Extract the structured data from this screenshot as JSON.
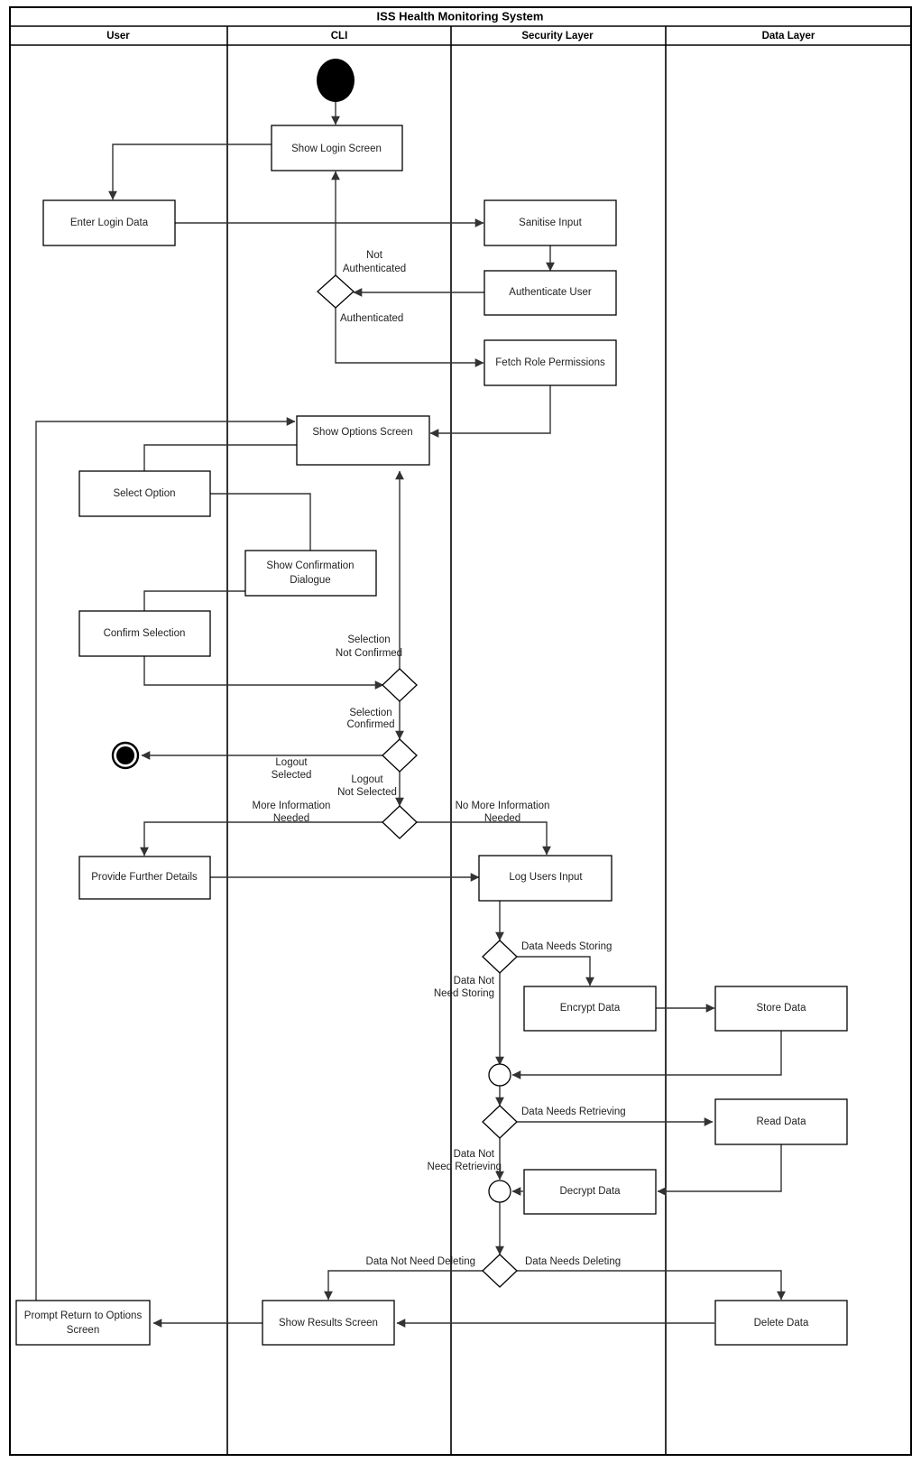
{
  "diagram": {
    "title": "ISS Health Monitoring System",
    "type": "uml-activity-swimlane",
    "lanes": [
      {
        "id": "user",
        "label": "User"
      },
      {
        "id": "cli",
        "label": "CLI"
      },
      {
        "id": "security",
        "label": "Security Layer"
      },
      {
        "id": "data",
        "label": "Data Layer"
      }
    ],
    "nodes": {
      "initial": {
        "label": "",
        "kind": "initial-node",
        "lane": "cli"
      },
      "show_login_screen": {
        "label": "Show  Login Screen",
        "kind": "action",
        "lane": "cli"
      },
      "enter_login_data": {
        "label": "Enter Login Data",
        "kind": "action",
        "lane": "user"
      },
      "sanitise_input": {
        "label": "Sanitise Input",
        "kind": "action",
        "lane": "security"
      },
      "authenticate_user": {
        "label": "Authenticate User",
        "kind": "action",
        "lane": "security"
      },
      "auth_decision": {
        "label": "",
        "kind": "decision",
        "lane": "cli"
      },
      "fetch_role_permissions": {
        "label": "Fetch Role Permissions",
        "kind": "action",
        "lane": "security"
      },
      "show_options_screen": {
        "label": "Show Options Screen",
        "kind": "action",
        "lane": "cli"
      },
      "select_option": {
        "label": "Select Option",
        "kind": "action",
        "lane": "user"
      },
      "show_confirmation_dialogue_line1": {
        "label": "Show Confirmation",
        "kind": "action-line",
        "lane": "cli"
      },
      "show_confirmation_dialogue_line2": {
        "label": "Dialogue",
        "kind": "action-line",
        "lane": "cli"
      },
      "confirm_selection": {
        "label": "Confirm Selection",
        "kind": "action",
        "lane": "user"
      },
      "confirm_decision": {
        "label": "",
        "kind": "decision",
        "lane": "cli"
      },
      "logout_decision": {
        "label": "",
        "kind": "decision",
        "lane": "cli"
      },
      "final": {
        "label": "",
        "kind": "final-node",
        "lane": "user"
      },
      "more_info_decision": {
        "label": "",
        "kind": "decision",
        "lane": "cli"
      },
      "provide_further_details": {
        "label": "Provide Further Details",
        "kind": "action",
        "lane": "user"
      },
      "log_users_input": {
        "label": "Log Users Input",
        "kind": "action",
        "lane": "security"
      },
      "store_decision": {
        "label": "",
        "kind": "decision",
        "lane": "security"
      },
      "encrypt_data": {
        "label": "Encrypt Data",
        "kind": "action",
        "lane": "security"
      },
      "store_data": {
        "label": "Store Data",
        "kind": "action",
        "lane": "data"
      },
      "merge_store": {
        "label": "",
        "kind": "merge",
        "lane": "security"
      },
      "retrieve_decision": {
        "label": "",
        "kind": "decision",
        "lane": "security"
      },
      "read_data": {
        "label": "Read Data",
        "kind": "action",
        "lane": "data"
      },
      "decrypt_data": {
        "label": "Decrypt Data",
        "kind": "action",
        "lane": "security"
      },
      "merge_retrieve": {
        "label": "",
        "kind": "merge",
        "lane": "security"
      },
      "delete_decision": {
        "label": "",
        "kind": "decision",
        "lane": "security"
      },
      "delete_data": {
        "label": "Delete Data",
        "kind": "action",
        "lane": "data"
      },
      "show_results_screen": {
        "label": "Show Results Screen",
        "kind": "action",
        "lane": "cli"
      },
      "prompt_return_line1": {
        "label": "Prompt Return to Options",
        "kind": "action-line",
        "lane": "user"
      },
      "prompt_return_line2": {
        "label": "Screen",
        "kind": "action-line",
        "lane": "user"
      }
    },
    "edge_labels": {
      "not_authenticated_l1": "Not",
      "not_authenticated_l2": "Authenticated",
      "authenticated": "Authenticated",
      "selection_not_confirmed_l1": "Selection",
      "selection_not_confirmed_l2": "Not Confirmed",
      "selection_confirmed_l1": "Selection",
      "selection_confirmed_l2": "Confirmed",
      "logout_selected_l1": "Logout",
      "logout_selected_l2": "Selected",
      "logout_not_selected_l1": "Logout",
      "logout_not_selected_l2": "Not Selected",
      "more_information_needed_l1": "More Information",
      "more_information_needed_l2": "Needed",
      "no_more_information_needed_l1": "No More Information",
      "no_more_information_needed_l2": "Needed",
      "data_needs_storing": "Data Needs Storing",
      "data_not_need_storing_l1": "Data Not",
      "data_not_need_storing_l2": "Need Storing",
      "data_needs_retrieving": "Data Needs Retrieving",
      "data_not_need_retrieving_l1": "Data Not",
      "data_not_need_retrieving_l2": "Need Retrieving",
      "data_needs_deleting": "Data Needs Deleting",
      "data_not_need_deleting": "Data Not Need Deleting"
    },
    "colors": {
      "background": "#ffffff",
      "stroke": "#000000",
      "flow_stroke": "#333333",
      "text": "#222222"
    }
  }
}
